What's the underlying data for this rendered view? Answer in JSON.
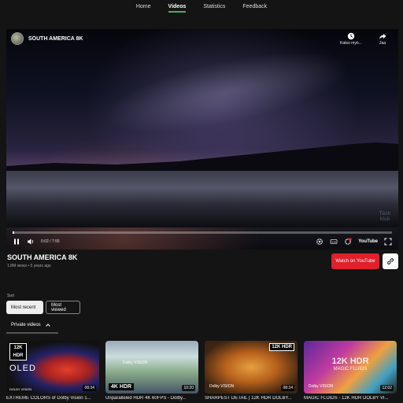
{
  "nav": {
    "items": [
      {
        "label": "Home",
        "active": false
      },
      {
        "label": "Videos",
        "active": true
      },
      {
        "label": "Statistics",
        "active": false
      },
      {
        "label": "Feedback",
        "active": false
      }
    ],
    "active_color": "#4caf50"
  },
  "player": {
    "channel": "SOUTH AMERICA 8K",
    "watch_later_label": "Katso myö...",
    "share_label": "Jaa",
    "watermark": "Tisch\nKlub",
    "time": "0:02 / 7:55",
    "progress": 0.004,
    "youtube_logo": "YouTube",
    "icons": [
      "pause-icon",
      "volume-icon",
      "settings-icon",
      "subtitles-icon",
      "fullscreen-icon",
      "clock-icon",
      "share-icon"
    ]
  },
  "video": {
    "title": "SOUTH AMERICA 8K",
    "meta": "1.8M views • 5 years ago",
    "watch_button": "Watch on YouTube",
    "accent": "#e0202a"
  },
  "sort": {
    "label": "Sort",
    "options": [
      "Most recent",
      "Most viewed"
    ],
    "selected": "Most recent"
  },
  "section": {
    "label": "Private videos"
  },
  "cards": [
    {
      "title": "EXTREME COLORS of Dolby Vision 1...",
      "duration": "08:34",
      "badge_a": "12K",
      "badge_b": "HDR",
      "badge_c": "OLED",
      "badge_d": "DOLBY VISION"
    },
    {
      "title": "Unparalleled HDR 4K 60FPS - Dolby...",
      "duration": "10:20",
      "badge_a": "4K HDR",
      "badge_b": "Dolby VISION"
    },
    {
      "title": "SHARPEST DETAIL | 12K HDR DOLBY...",
      "duration": "08:24",
      "badge_a": "12K HDR",
      "badge_b": "Dolby VISION"
    },
    {
      "title": "MAGIC FLUIDS - 12K HDR DOLBY VI...",
      "duration": "12:02",
      "badge_a": "12K HDR",
      "badge_b": "MAGIC FLUIDS",
      "badge_c": "Dolby VISION"
    }
  ]
}
